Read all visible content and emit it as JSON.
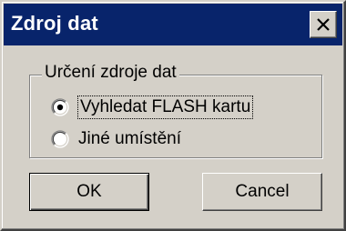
{
  "dialog": {
    "title": "Zdroj dat",
    "close_label": "close",
    "titlebar_color": "#08246b",
    "face_color": "#d4d0c8"
  },
  "group": {
    "label": "Určení zdroje dat",
    "options": [
      {
        "label": "Vyhledat FLASH kartu",
        "selected": true,
        "focused": true
      },
      {
        "label": "Jiné umístění",
        "selected": false,
        "focused": false
      }
    ]
  },
  "buttons": {
    "ok_label": "OK",
    "cancel_label": "Cancel"
  }
}
